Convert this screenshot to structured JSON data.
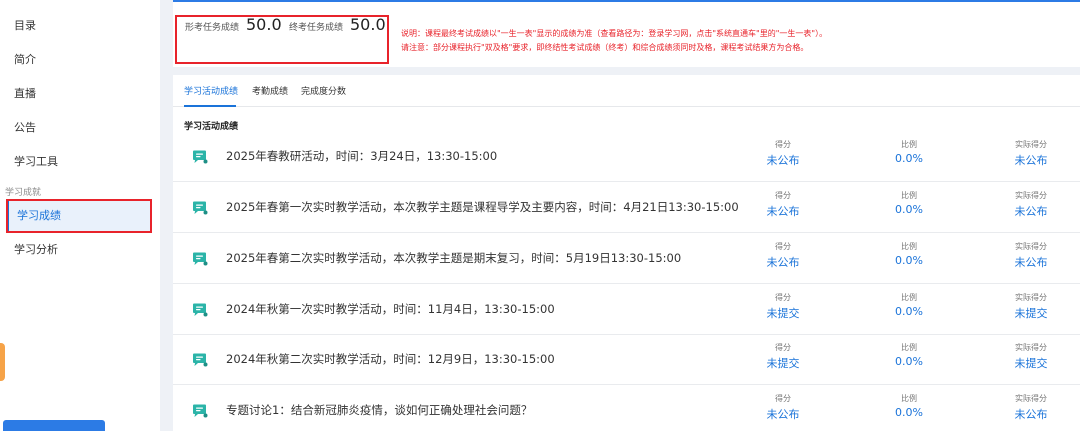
{
  "sidebar": {
    "items": [
      {
        "label": "目录"
      },
      {
        "label": "简介"
      },
      {
        "label": "直播"
      },
      {
        "label": "公告"
      },
      {
        "label": "学习工具"
      }
    ],
    "section_label": "学习成就",
    "active_item": "学习成绩",
    "after_items": [
      {
        "label": "学习分析"
      }
    ]
  },
  "scores": {
    "formative_label": "形考任务成绩",
    "formative_value": "50.0",
    "final_label": "终考任务成绩",
    "final_value": "50.0"
  },
  "notice": {
    "line1": "说明：课程最终考试成绩以\"一生一表\"显示的成绩为准（查看路径为：登录学习网，点击\"系统直通车\"里的\"一生一表\"）。",
    "line2": "请注意：部分课程执行\"双及格\"要求，即终结性考试成绩（终考）和综合成绩须同时及格，课程考试结果方为合格。"
  },
  "tabs": [
    {
      "label": "学习活动成绩",
      "active": true
    },
    {
      "label": "考勤成绩",
      "active": false
    },
    {
      "label": "完成度分数",
      "active": false
    }
  ],
  "section_title": "学习活动成绩",
  "columns": {
    "score": "得分",
    "ratio": "比例",
    "actual": "实际得分"
  },
  "activities": [
    {
      "title": "2025年春教研活动，时间：3月24日，13:30-15:00",
      "score": "未公布",
      "ratio": "0.0%",
      "actual": "未公布"
    },
    {
      "title": "2025年春第一次实时教学活动，本次教学主题是课程导学及主要内容，时间：4月21日13:30-15:00",
      "score": "未公布",
      "ratio": "0.0%",
      "actual": "未公布"
    },
    {
      "title": "2025年春第二次实时教学活动，本次教学主题是期末复习，时间：5月19日13:30-15:00",
      "score": "未公布",
      "ratio": "0.0%",
      "actual": "未公布"
    },
    {
      "title": "2024年秋第一次实时教学活动，时间：11月4日，13:30-15:00",
      "score": "未提交",
      "ratio": "0.0%",
      "actual": "未提交"
    },
    {
      "title": "2024年秋第二次实时教学活动，时间：12月9日，13:30-15:00",
      "score": "未提交",
      "ratio": "0.0%",
      "actual": "未提交"
    },
    {
      "title": "专题讨论1：结合新冠肺炎疫情，谈如何正确处理社会问题？",
      "score": "未公布",
      "ratio": "0.0%",
      "actual": "未公布"
    }
  ],
  "icons": {
    "activity": "chat-bubble-icon"
  },
  "colors": {
    "accent": "#1a73d9",
    "alert": "#e8232b",
    "icon": "#2bb4a8"
  }
}
